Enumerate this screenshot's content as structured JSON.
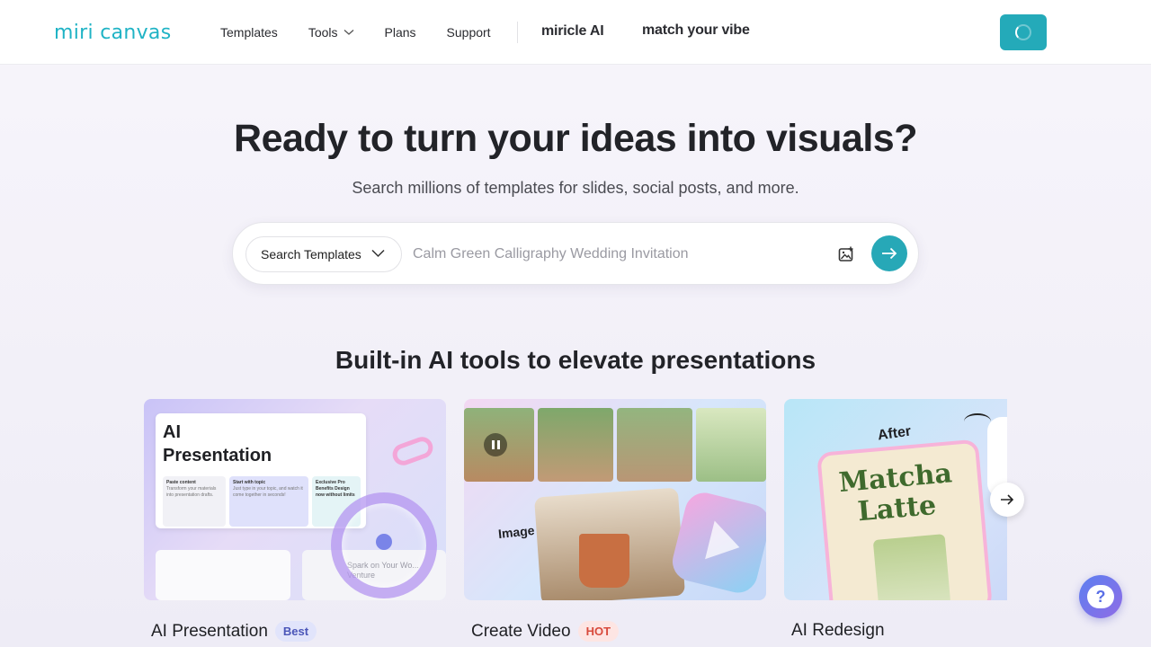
{
  "header": {
    "logo": "miri canvas",
    "nav": [
      "Templates",
      "Tools",
      "Plans",
      "Support"
    ],
    "miricle": "miricle AI",
    "vibe": "match your vibe"
  },
  "hero": {
    "title": "Ready to turn your ideas into visuals?",
    "subtitle": "Search millions of templates for slides, social posts, and more."
  },
  "search": {
    "type_label": "Search Templates",
    "placeholder": "Calm Green Calligraphy Wedding Invitation"
  },
  "section": {
    "title": "Built-in AI tools to elevate presentations"
  },
  "cards": [
    {
      "label": "AI Presentation",
      "badge": "Best",
      "thumb": {
        "heading_line1": "AI",
        "heading_line2": "Presentation",
        "box1_title": "Paste content",
        "box1_text": "Transform your materials into presentation drafts.",
        "box2_title": "Start with topic",
        "box2_text": "Just type in your topic, and watch it come together in seconds!",
        "box3_title": "Exclusive Pro Benefits Design now without limits",
        "watermark": "Spark on Your Wo... Venture"
      }
    },
    {
      "label": "Create Video",
      "badge": "HOT",
      "thumb": {
        "image_label": "Image"
      }
    },
    {
      "label": "AI Redesign",
      "badge": "",
      "thumb": {
        "after_label": "After",
        "title_line1": "Matcha",
        "title_line2": "Latte"
      }
    }
  ],
  "colors": {
    "brand": "#1fb3c5",
    "accent": "#27a8b7"
  }
}
